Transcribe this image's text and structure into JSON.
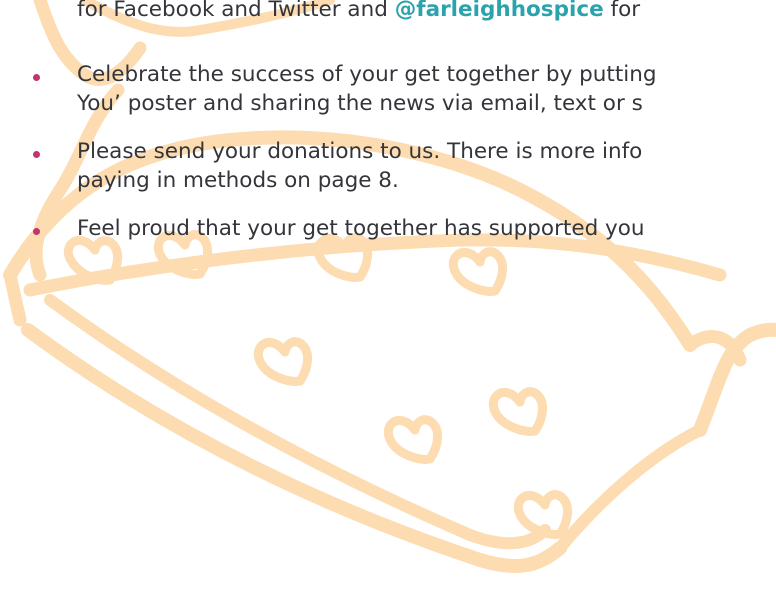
{
  "colors": {
    "text": "#34353a",
    "bullet": "#c2336f",
    "handle": "#2aa3ad",
    "teapot_outline": "#fcdcb0"
  },
  "illustration": {
    "icon": "teapot-with-hearts"
  },
  "social_line": {
    "part1": "for Facebook and Twitter and ",
    "handle": "@farleighhospice",
    "part2": " for"
  },
  "bullets": [
    {
      "lines": [
        "Celebrate the success of your get together by putting",
        "You’ poster and sharing the news via email, text or s"
      ]
    },
    {
      "lines": [
        "Please send your donations to us. There is more info",
        "paying in methods on page 8."
      ]
    },
    {
      "lines": [
        "Feel proud that your get together has supported you"
      ]
    }
  ]
}
